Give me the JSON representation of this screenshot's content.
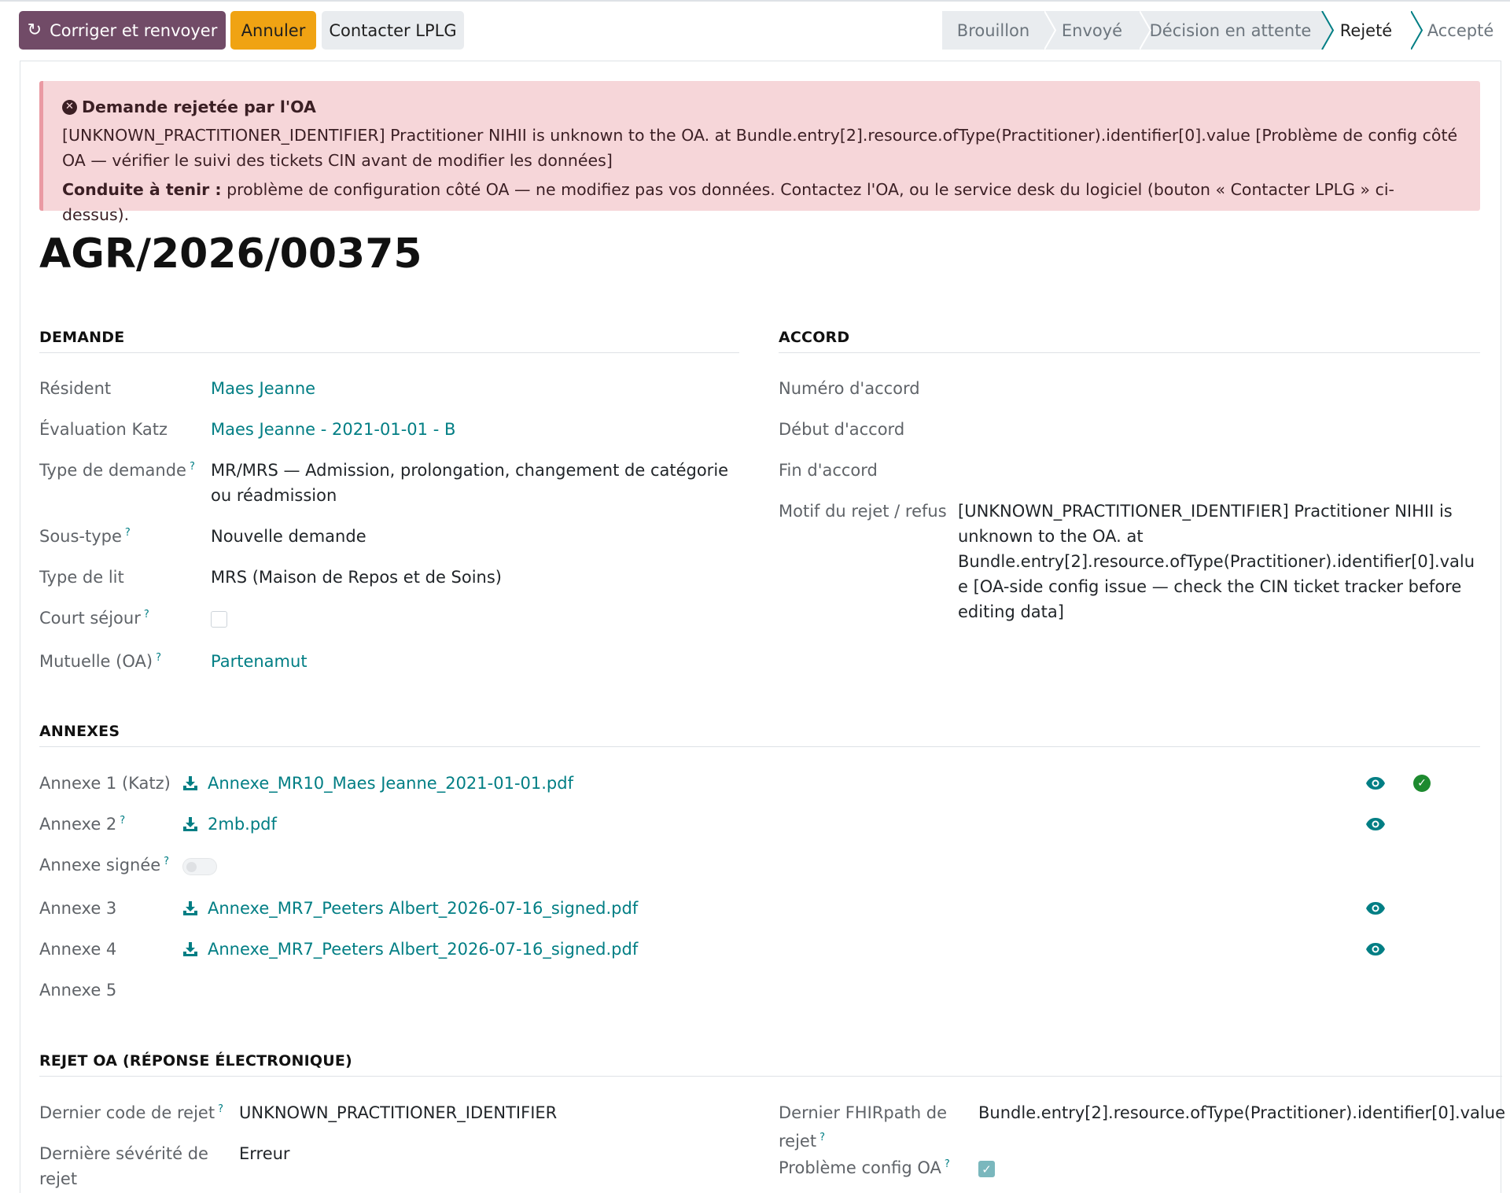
{
  "actions": {
    "fix_resend": "Corriger et renvoyer",
    "cancel": "Annuler",
    "contact": "Contacter LPLG"
  },
  "statusbar": [
    "Brouillon",
    "Envoyé",
    "Décision en attente",
    "Rejeté",
    "Accepté"
  ],
  "statusbar_active": "Rejeté",
  "alert": {
    "title": "Demande rejetée par l'OA",
    "message": "[UNKNOWN_PRACTITIONER_IDENTIFIER] Practitioner NIHII is unknown to the OA. at Bundle.entry[2].resource.ofType(Practitioner).identifier[0].value [Problème de config côté OA — vérifier le suivi des tickets CIN avant de modifier les données]",
    "conduct_label": "Conduite à tenir :",
    "conduct_text": "problème de configuration côté OA — ne modifiez pas vos données. Contactez l'OA, ou le service desk du logiciel (bouton « Contacter LPLG » ci-dessus)."
  },
  "record_title": "AGR/2026/00375",
  "demande": {
    "heading": "DEMANDE",
    "resident_label": "Résident",
    "resident": "Maes Jeanne",
    "katz_label": "Évaluation Katz",
    "katz": "Maes Jeanne - 2021-01-01 - B",
    "type_label": "Type de demande",
    "type": "MR/MRS — Admission, prolongation, changement de catégorie ou réadmission",
    "subtype_label": "Sous-type",
    "subtype": "Nouvelle demande",
    "bed_label": "Type de lit",
    "bed": "MRS (Maison de Repos et de Soins)",
    "short_stay_label": "Court séjour",
    "mutual_label": "Mutuelle (OA)",
    "mutual": "Partenamut"
  },
  "accord": {
    "heading": "ACCORD",
    "number_label": "Numéro d'accord",
    "start_label": "Début d'accord",
    "end_label": "Fin d'accord",
    "reason_label": "Motif du rejet / refus",
    "reason": "[UNKNOWN_PRACTITIONER_IDENTIFIER] Practitioner NIHII is unknown to the OA. at Bundle.entry[2].resource.ofType(Practitioner).identifier[0].value [OA-side config issue — check the CIN ticket tracker before editing data]"
  },
  "annexes": {
    "heading": "ANNEXES",
    "a1_label": "Annexe 1 (Katz)",
    "a1_file": "Annexe_MR10_Maes Jeanne_2021-01-01.pdf",
    "a2_label": "Annexe 2",
    "a2_file": "2mb.pdf",
    "signed_label": "Annexe signée",
    "a3_label": "Annexe 3",
    "a3_file": "Annexe_MR7_Peeters Albert_2026-07-16_signed.pdf",
    "a4_label": "Annexe 4",
    "a4_file": "Annexe_MR7_Peeters Albert_2026-07-16_signed.pdf",
    "a5_label": "Annexe 5"
  },
  "rejection": {
    "heading": "REJET OA (RÉPONSE ÉLECTRONIQUE)",
    "code_label": "Dernier code de rejet",
    "code": "UNKNOWN_PRACTITIONER_IDENTIFIER",
    "severity_label": "Dernière sévérité de rejet",
    "severity": "Erreur",
    "fhirpath_label": "Dernier FHIRpath de rejet",
    "fhirpath": "Bundle.entry[2].resource.ofType(Practitioner).identifier[0].value",
    "config_label": "Problème config OA"
  },
  "help_marker": "?",
  "colors": {
    "primary": "#714b67",
    "warning": "#f0a313",
    "link": "#017e84",
    "danger_bg": "#f6d6d9",
    "success": "#1d8a2f"
  }
}
